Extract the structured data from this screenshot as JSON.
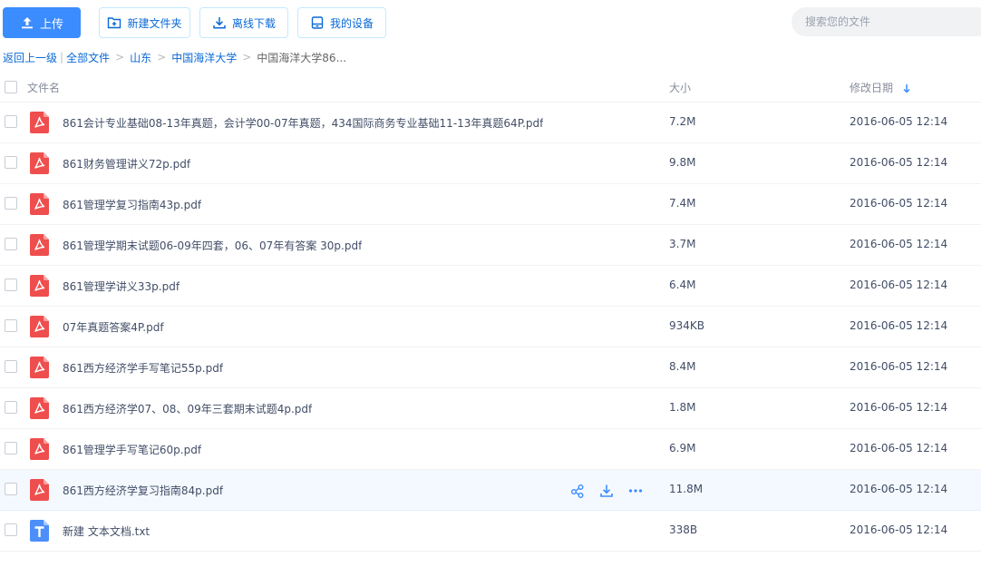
{
  "toolbar": {
    "upload_label": "上传",
    "new_folder_label": "新建文件夹",
    "offline_download_label": "离线下载",
    "my_devices_label": "我的设备",
    "search_placeholder": "搜索您的文件"
  },
  "breadcrumb": {
    "back": "返回上一级",
    "divider": "|",
    "all_files": "全部文件",
    "items": [
      "山东",
      "中国海洋大学"
    ],
    "current": "中国海洋大学86...",
    "separator": ">"
  },
  "table": {
    "columns": {
      "name": "文件名",
      "size": "大小",
      "modified": "修改日期"
    },
    "rows": [
      {
        "name": "861会计专业基础08-13年真题，会计学00-07年真题，434国际商务专业基础11-13年真题64P.pdf",
        "size": "7.2M",
        "date": "2016-06-05 12:14",
        "type": "pdf"
      },
      {
        "name": "861财务管理讲义72p.pdf",
        "size": "9.8M",
        "date": "2016-06-05 12:14",
        "type": "pdf"
      },
      {
        "name": "861管理学复习指南43p.pdf",
        "size": "7.4M",
        "date": "2016-06-05 12:14",
        "type": "pdf"
      },
      {
        "name": "861管理学期末试题06-09年四套，06、07年有答案 30p.pdf",
        "size": "3.7M",
        "date": "2016-06-05 12:14",
        "type": "pdf"
      },
      {
        "name": "861管理学讲义33p.pdf",
        "size": "6.4M",
        "date": "2016-06-05 12:14",
        "type": "pdf"
      },
      {
        "name": "07年真题答案4P.pdf",
        "size": "934KB",
        "date": "2016-06-05 12:14",
        "type": "pdf"
      },
      {
        "name": "861西方经济学手写笔记55p.pdf",
        "size": "8.4M",
        "date": "2016-06-05 12:14",
        "type": "pdf"
      },
      {
        "name": "861西方经济学07、08、09年三套期末试题4p.pdf",
        "size": "1.8M",
        "date": "2016-06-05 12:14",
        "type": "pdf"
      },
      {
        "name": "861管理学手写笔记60p.pdf",
        "size": "6.9M",
        "date": "2016-06-05 12:14",
        "type": "pdf"
      },
      {
        "name": "861西方经济学复习指南84p.pdf",
        "size": "11.8M",
        "date": "2016-06-05 12:14",
        "type": "pdf",
        "hover": true
      },
      {
        "name": "新建 文本文档.txt",
        "size": "338B",
        "date": "2016-06-05 12:14",
        "type": "txt"
      }
    ]
  },
  "colors": {
    "primary": "#3b8cff",
    "link": "#0a69d6",
    "pdf_icon": "#ef4e4e",
    "txt_icon": "#4c8ffa",
    "hover_row": "#f4f9ff"
  },
  "icons": {
    "upload": "upload-icon",
    "new_folder": "new-folder-icon",
    "offline_download": "download-icon",
    "devices": "device-icon",
    "sort": "sort-down-icon",
    "share": "share-icon",
    "download_row": "download-icon",
    "more": "more-icon"
  }
}
